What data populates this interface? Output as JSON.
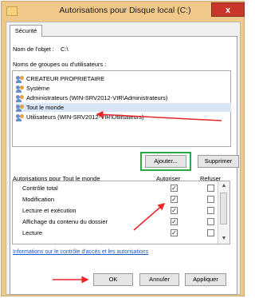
{
  "window": {
    "title": "Autorisations pour Disque local (C:)",
    "close_label": "x"
  },
  "tab": {
    "label": "Sécurité"
  },
  "object": {
    "label": "Nom de l'objet :",
    "value": "C:\\"
  },
  "groups": {
    "label": "Noms de groupes ou d'utilisateurs :",
    "items": [
      {
        "label": "CREATEUR PROPRIETAIRE",
        "selected": false
      },
      {
        "label": "Système",
        "selected": false
      },
      {
        "label": "Administrateurs (WIN-SRV2012-VIR\\Administrateurs)",
        "selected": false
      },
      {
        "label": "Tout le monde",
        "selected": true
      },
      {
        "label": "Utilisateurs (WIN-SRV2012-VIR\\Utilisateurs)",
        "selected": false
      }
    ]
  },
  "buttons": {
    "add": "Ajouter...",
    "remove": "Supprimer",
    "ok": "OK",
    "cancel": "Annuler",
    "apply": "Appliquer"
  },
  "permissions": {
    "label": "Autorisations pour Tout le monde",
    "allow_header": "Autoriser",
    "deny_header": "Refuser",
    "rows": [
      {
        "label": "Contrôle total",
        "allow": true,
        "deny": false
      },
      {
        "label": "Modification",
        "allow": true,
        "deny": false
      },
      {
        "label": "Lecture et exécution",
        "allow": true,
        "deny": false
      },
      {
        "label": "Affichage du contenu du dossier",
        "allow": true,
        "deny": false
      },
      {
        "label": "Lecture",
        "allow": true,
        "deny": false
      }
    ]
  },
  "info_link": "Informations sur le contrôle d'accès et les autorisations",
  "colors": {
    "annotation_arrow": "#e8262a",
    "highlight_box": "#2aa84a",
    "selection": "#d8e6f5"
  }
}
